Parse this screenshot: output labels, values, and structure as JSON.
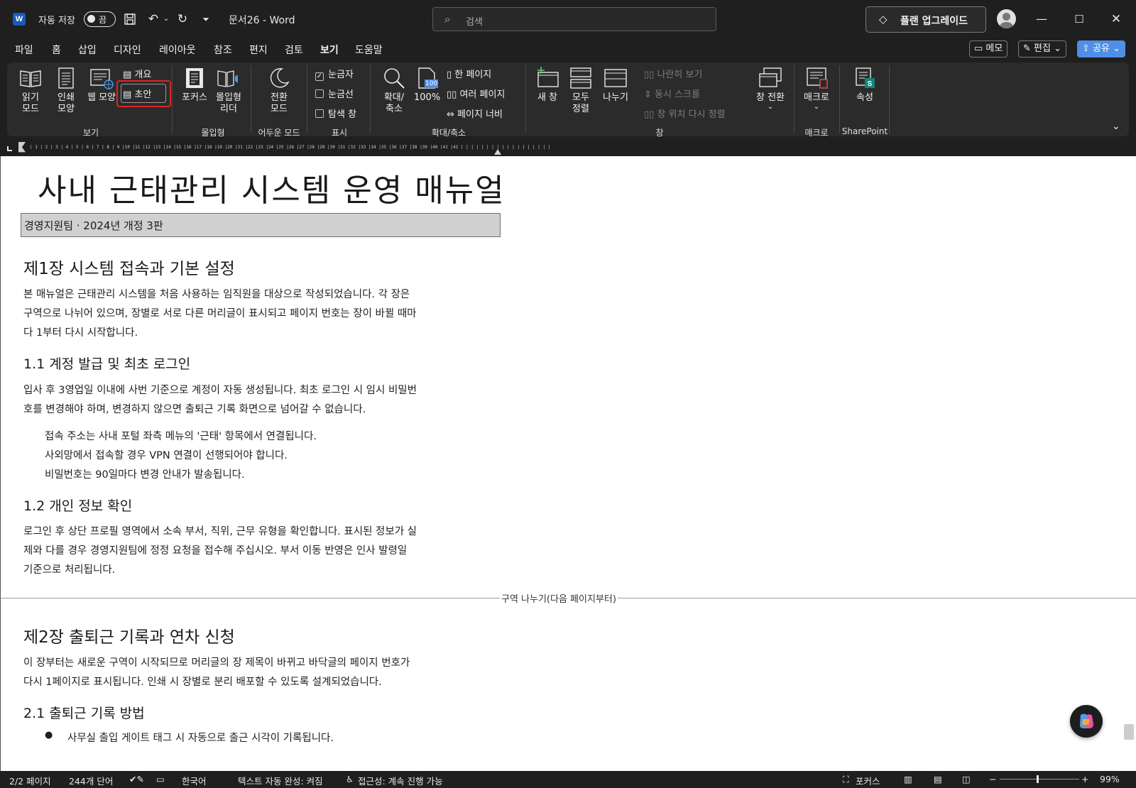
{
  "titlebar": {
    "app_logo": "W",
    "autosave_label": "자동 저장",
    "autosave_state": "끔",
    "doc_title": "문서26 - Word",
    "search_placeholder": "검색",
    "upgrade_label": "플랜 업그레이드",
    "icons": [
      "word-logo-icon",
      "save-icon",
      "undo-icon",
      "redo-icon",
      "customize-qat-icon",
      "search-icon",
      "diamond-icon",
      "avatar-icon",
      "minimize-icon",
      "maximize-icon",
      "close-icon"
    ]
  },
  "menu": {
    "tabs": [
      "파일",
      "홈",
      "삽입",
      "디자인",
      "레이아웃",
      "참조",
      "편지",
      "검토",
      "보기",
      "도움말"
    ],
    "active_tab": "보기",
    "memo_label": "메모",
    "edit_label": "편집",
    "share_label": "공유"
  },
  "ribbon": {
    "view": {
      "read_mode": "읽기 모드",
      "print_layout": "인쇄 모양",
      "web_layout": "웹 모양",
      "outline": "개요",
      "draft": "초안",
      "group": "보기"
    },
    "immersive": {
      "focus": "포커스",
      "immersive_reader": "몰입형 리더",
      "group": "몰입형"
    },
    "dark": {
      "switch_mode": "전환 모드",
      "group": "어두운 모드"
    },
    "show": {
      "ruler": "눈금자",
      "gridlines": "눈금선",
      "nav_pane": "탐색 창",
      "ruler_checked": true,
      "group": "표시"
    },
    "zoom": {
      "zoom": "확대/축소",
      "hundred": "100%",
      "hundred_badge": "100",
      "one_page": "한 페이지",
      "multi_page": "여러 페이지",
      "page_width": "페이지 너비",
      "group": "확대/축소"
    },
    "window": {
      "new_window": "새 창",
      "arrange_all": "모두 정렬",
      "split": "나누기",
      "side_by_side": "나란히 보기",
      "sync_scroll": "동시 스크롤",
      "reset_position": "창 위치 다시 정렬",
      "switch_window": "창 전환",
      "group": "창"
    },
    "macros": {
      "macros": "매크로",
      "group": "매크로"
    },
    "sharepoint": {
      "properties": "속성",
      "group": "SharePoint"
    }
  },
  "document": {
    "title": "사내 근태관리 시스템 운영 매뉴얼",
    "subtitle": "경영지원팀 · 2024년 개정 3판",
    "ch1_heading": "제1장 시스템 접속과 기본 설정",
    "ch1_para": [
      "본 매뉴얼은 근태관리 시스템을 처음 사용하는 임직원을 대상으로 작성되었습니다. 각 장은",
      "구역으로 나뉘어 있으며, 장별로 서로 다른 머리글이 표시되고 페이지 번호는 장이 바뀔 때마",
      "다 1부터 다시 시작합니다."
    ],
    "s11_heading": "1.1 계정 발급 및 최초 로그인",
    "s11_para": [
      "입사 후 3영업일 이내에 사번 기준으로 계정이 자동 생성됩니다. 최초 로그인 시 임시 비밀번",
      "호를 변경해야 하며, 변경하지 않으면 출퇴근 기록 화면으로 넘어갈 수 없습니다."
    ],
    "s11_list": [
      "접속 주소는 사내 포털 좌측 메뉴의 '근태' 항목에서 연결됩니다.",
      "사외망에서 접속할 경우 VPN 연결이 선행되어야 합니다.",
      "비밀번호는 90일마다 변경 안내가 발송됩니다."
    ],
    "s12_heading": "1.2 개인 정보 확인",
    "s12_para": [
      "로그인 후 상단 프로필 영역에서 소속 부서, 직위, 근무 유형을 확인합니다. 표시된 정보가 실",
      "제와 다를 경우 경영지원팀에 정정 요청을 접수해 주십시오. 부서 이동 반영은 인사 발령일",
      "기준으로 처리됩니다."
    ],
    "section_break": "구역 나누기(다음 페이지부터)",
    "ch2_heading": "제2장 출퇴근 기록과 연차 신청",
    "ch2_para": [
      "이 장부터는 새로운 구역이 시작되므로 머리글의 장 제목이 바뀌고 바닥글의 페이지 번호가",
      "다시 1페이지로 표시됩니다. 인쇄 시 장별로 분리 배포할 수 있도록 설계되었습니다."
    ],
    "s21_heading": "2.1 출퇴근 기록 방법",
    "s21_bullet": "사무실 출입 게이트 태그 시 자동으로 출근 시각이 기록됩니다."
  },
  "status": {
    "page": "2/2 페이지",
    "words": "244개 단어",
    "language": "한국어",
    "autocomplete": "텍스트 자동 완성: 켜짐",
    "accessibility": "접근성: 계속 진행 가능",
    "focus": "포커스",
    "zoom": "99%",
    "zoom_level": 0.99
  },
  "colors": {
    "chrome_bg": "#1f1f1f",
    "ribbon_bg": "#2b2b2b",
    "highlight": "#e02424",
    "share_blue": "#4f8fe6",
    "word_blue": "#185abd",
    "subtitle_fill": "#d0d0d0"
  }
}
